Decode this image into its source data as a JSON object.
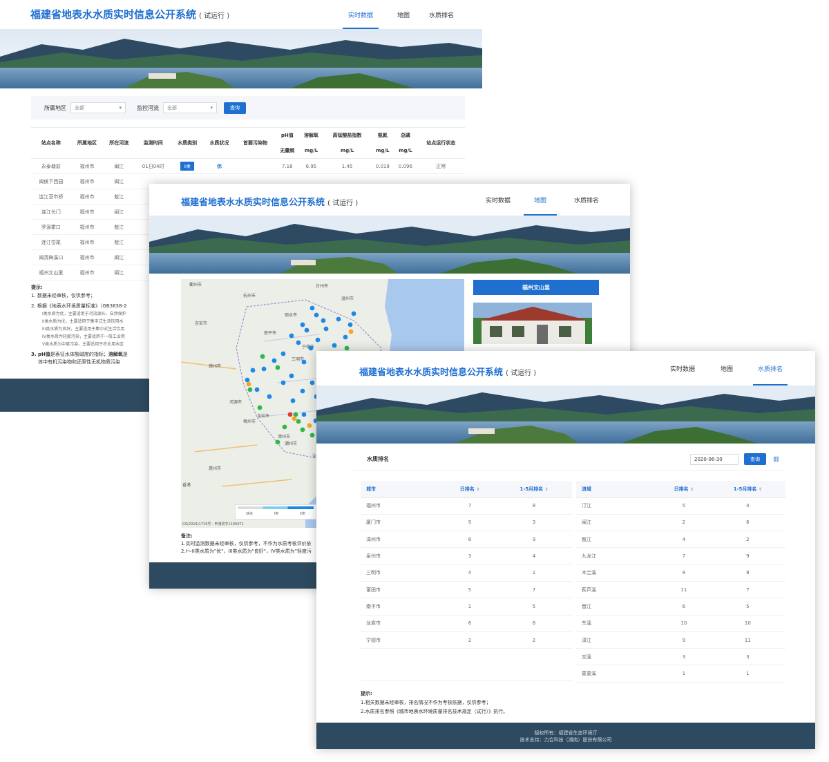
{
  "app": {
    "title": "福建省地表水水质实时信息公开系统",
    "trial": "( 试运行 )",
    "tabs": [
      "实时数据",
      "地图",
      "水质排名"
    ]
  },
  "realtime": {
    "filters": {
      "region_label": "所属地区",
      "region_value": "全部",
      "river_label": "监控河流",
      "river_value": "全部",
      "query": "查询"
    },
    "columns": {
      "station": "站点名称",
      "region": "所属地区",
      "river": "所在河流",
      "time": "监测时间",
      "category": "水质类别",
      "status": "水质状况",
      "pollutant": "首要污染物",
      "ph": "pH值",
      "ph_unit": "无量纲",
      "do": "溶解氧",
      "do_unit": "mg/L",
      "cod": "高锰酸盐指数",
      "cod_unit": "mg/L",
      "nh": "氨氮",
      "nh_unit": "mg/L",
      "tp": "总磷",
      "tp_unit": "mg/L",
      "run": "站点运行状态"
    },
    "first_row": {
      "station": "永泰塘前",
      "region": "福州市",
      "river": "闽江",
      "time": "01日04时",
      "category": "II类",
      "status": "优",
      "pollutant": "",
      "ph": "7.18",
      "do": "6.95",
      "cod": "1.45",
      "nh": "0.018",
      "tp": "0.096",
      "run": "正常"
    },
    "rows": [
      [
        "闽侯下西园",
        "福州市",
        "闽江"
      ],
      [
        "连江苔市桥",
        "福州市",
        "敖江"
      ],
      [
        "连江长门",
        "福州市",
        "闽江"
      ],
      [
        "罗源霍口",
        "福州市",
        "敖江"
      ],
      [
        "连江岱尾",
        "福州市",
        "敖江"
      ],
      [
        "闽清梅溪口",
        "福州市",
        "闽江"
      ],
      [
        "福州文山里",
        "福州市",
        "闽江"
      ]
    ],
    "tips": {
      "heading": "提示:",
      "t1": "1. 数据未经审核，仅供参考；",
      "t2": "2. 根据《地表水环境质量标准》（GB3838-2",
      "s1": "I类水质为优，主要适用于河流源头、自然保护",
      "s2": "II类水质为优，主要适用于集中式生活饮用水",
      "s3": "III类水质为良好，主要适用于集中式生活饮用",
      "s4": "IV类水质为轻度污染，主要适用于一般工业用",
      "s5": "V类水质为中度污染，主要适用于农业用水区",
      "t3a": "3. pH值",
      "t3b": "是表征水体酸碱度的指标；",
      "t3c": "溶解氧",
      "t3d": "是",
      "t3e": "体中有机污染物和还原性无机物质污染"
    }
  },
  "mapview": {
    "station_title": "福州文山里",
    "cities": [
      "衢州市",
      "杭州市",
      "台州市",
      "温州市",
      "丽水市",
      "宁德市",
      "南平市",
      "三明市",
      "赣州市",
      "龙岩市",
      "梅州市",
      "潮州市",
      "汕头市",
      "泉州市",
      "漳州市",
      "惠州市",
      "香港",
      "河源市",
      "吉安市"
    ],
    "legend": [
      "缺失",
      "I类",
      "II类"
    ],
    "copyright": "GS(2019)1719号 - 甲测资字1100471",
    "notes_heading": "备注:",
    "n1": "1.实时监测数据未经审核，仅供参考，不作为水质考核评价依",
    "n2": "2.I～II类水质为\"优\"，III类水质为\"良好\"，IV类水质为\"轻度污"
  },
  "ranking": {
    "heading": "水质排名",
    "date": "2020-06-30",
    "query": "查询",
    "city_cols": [
      "城市",
      "日排名",
      "1-5月排名"
    ],
    "river_cols": [
      "流域",
      "日排名",
      "1-5月排名"
    ],
    "cities": [
      [
        "福州市",
        "7",
        "8"
      ],
      [
        "厦门市",
        "9",
        "3"
      ],
      [
        "漳州市",
        "8",
        "9"
      ],
      [
        "泉州市",
        "3",
        "4"
      ],
      [
        "三明市",
        "4",
        "1"
      ],
      [
        "莆田市",
        "5",
        "7"
      ],
      [
        "南平市",
        "1",
        "5"
      ],
      [
        "龙岩市",
        "6",
        "6"
      ],
      [
        "宁德市",
        "2",
        "2"
      ]
    ],
    "rivers": [
      [
        "汀江",
        "5",
        "4"
      ],
      [
        "闽江",
        "2",
        "6"
      ],
      [
        "敖江",
        "4",
        "2"
      ],
      [
        "九龙江",
        "7",
        "9"
      ],
      [
        "木兰溪",
        "8",
        "8"
      ],
      [
        "萩芦溪",
        "11",
        "7"
      ],
      [
        "晋江",
        "6",
        "5"
      ],
      [
        "东溪",
        "10",
        "10"
      ],
      [
        "漳江",
        "9",
        "11"
      ],
      [
        "交溪",
        "3",
        "3"
      ],
      [
        "霍童溪",
        "1",
        "1"
      ]
    ],
    "tips_heading": "提示:",
    "tip1": "1.相关数据未经审核，排名情况不作为考核依据，仅供参考；",
    "tip2": "2.水质排名参照《城市地表水环境质量排名技术规定（试行）》执行。",
    "footer1": "版权所有：福建省生态环境厅",
    "footer2": "技术支持：力合科技（湖南）股份有限公司"
  },
  "colors": {
    "accent": "#1f6fd1",
    "footer": "#2e4a60",
    "dot_blue": "#1e88e5",
    "dot_green": "#2eb84b",
    "dot_orange": "#f5a623",
    "dot_red": "#e53935"
  }
}
